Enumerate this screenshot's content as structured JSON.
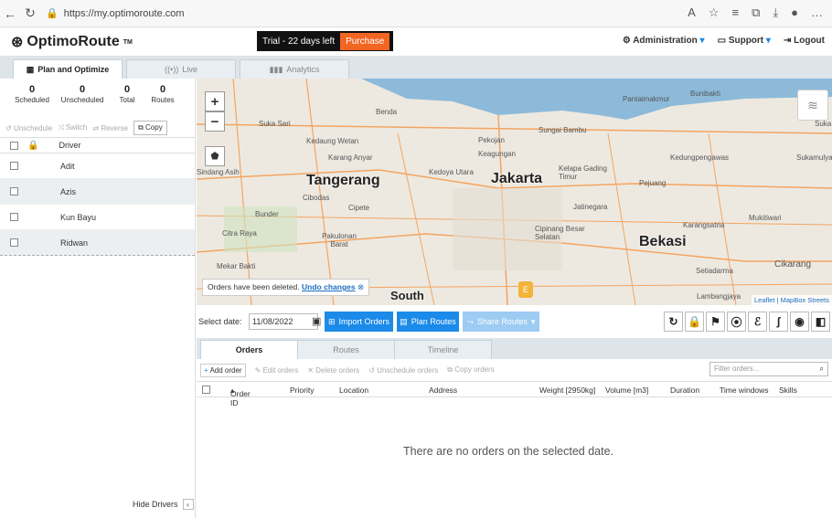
{
  "browser": {
    "url": "https://my.optimoroute.com"
  },
  "header": {
    "logo": "OptimoRoute",
    "trial": "Trial - 22 days left",
    "purchase": "Purchase",
    "administration": "Administration",
    "support": "Support",
    "logout": "Logout"
  },
  "tabs": [
    "Plan and Optimize",
    "Live",
    "Analytics"
  ],
  "stats": [
    {
      "value": "0",
      "label": "Scheduled"
    },
    {
      "value": "0",
      "label": "Unscheduled"
    },
    {
      "value": "0",
      "label": "Total"
    },
    {
      "value": "0",
      "label": "Routes"
    }
  ],
  "actions": {
    "unschedule": "Unschedule",
    "switch": "Switch",
    "reverse": "Reverse",
    "copy": "Copy"
  },
  "drivers": {
    "header": "Driver",
    "items": [
      "Adit",
      "Azis",
      "Kun Bayu",
      "Ridwan"
    ]
  },
  "hide_drivers": "Hide Drivers",
  "map": {
    "notice": "Orders have been deleted.",
    "undo": "Undo changes",
    "attribution": "Leaflet | MapBox Streets",
    "cities": [
      "Jakarta",
      "Tangerang",
      "Bekasi",
      "South"
    ],
    "towns": [
      "Benda",
      "Suka Sari",
      "Kedaung Wetan",
      "Karang Anyar",
      "Sindang Asih",
      "Cibodas",
      "Cipete",
      "Bunder",
      "Citra Raya",
      "Pakulonan Barat",
      "Mekar Bakti",
      "Pekojan",
      "Keagungan",
      "Kedoya Utara",
      "Sungai Bambu",
      "Kelapa Gading Timur",
      "Jatinegara",
      "Cipinang Besar Selatan",
      "Pantaimakmur",
      "Bunibakti",
      "Kedungpengawas",
      "Pejuang",
      "Karangsatria",
      "Mukitiwari",
      "Setiadarma",
      "Cikarang",
      "Lambangjaya",
      "Sukamulya",
      "Suka"
    ]
  },
  "toolbar": {
    "select_date_label": "Select date:",
    "date": "11/08/2022",
    "import": "Import Orders",
    "plan": "Plan Routes",
    "share": "Share Routes"
  },
  "subtabs": [
    "Orders",
    "Routes",
    "Timeline"
  ],
  "order_actions": {
    "add": "Add order",
    "edit": "Edit orders",
    "delete": "Delete orders",
    "unschedule": "Unschedule orders",
    "copy": "Copy orders",
    "filter_placeholder": "Filter orders..."
  },
  "columns": [
    "Order ID",
    "Priority",
    "Location",
    "Address",
    "Weight [2950kg]",
    "Volume [m3]",
    "Duration",
    "Time windows",
    "Skills"
  ],
  "empty_message": "There are no orders on the selected date."
}
